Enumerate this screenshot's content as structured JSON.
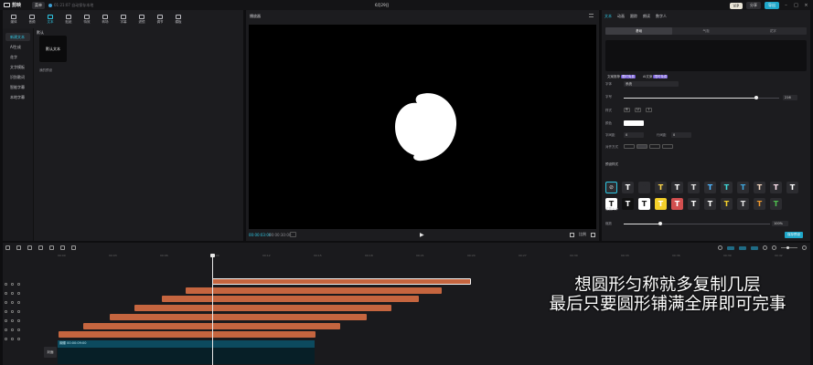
{
  "app": {
    "brand": "剪映",
    "menu_label": "菜单",
    "autosave": "01:21:07 自动保存本地",
    "project_title": "6月29日",
    "vip_label": "VIP",
    "share_label": "分享",
    "export_label": "导出"
  },
  "tools": [
    {
      "label": "媒体",
      "icon": "media-icon"
    },
    {
      "label": "音频",
      "icon": "audio-icon"
    },
    {
      "label": "文本",
      "icon": "text-icon"
    },
    {
      "label": "贴纸",
      "icon": "sticker-icon"
    },
    {
      "label": "特效",
      "icon": "effects-icon"
    },
    {
      "label": "转场",
      "icon": "transition-icon"
    },
    {
      "label": "字幕",
      "icon": "caption-icon"
    },
    {
      "label": "滤镜",
      "icon": "filter-icon"
    },
    {
      "label": "调节",
      "icon": "adjust-icon"
    },
    {
      "label": "模板",
      "icon": "template-icon"
    }
  ],
  "categories": [
    "新建文本",
    "AI生成",
    "花字",
    "文字模板",
    "识别歌词",
    "智能字幕",
    "本地字幕"
  ],
  "library": {
    "heading": "默认",
    "card_text": "默认文本",
    "caption": "我的预设"
  },
  "player": {
    "title": "播放器",
    "time_current": "00:00:03:00",
    "time_total": "00:00:30:00",
    "ratio_label": "比例"
  },
  "inspector": {
    "tabs": [
      "文本",
      "动画",
      "跟踪",
      "朗读",
      "数字人"
    ],
    "subtabs": [
      "基础",
      "气泡",
      "花字"
    ],
    "ai_buttons": [
      {
        "label": "文案推荐",
        "badge": "限时免费"
      },
      {
        "label": "AI文案",
        "badge": "限时免费"
      }
    ],
    "font_label": "字体",
    "font_value": "系统",
    "size_label": "字号",
    "size_value": "216",
    "size_fraction": 0.85,
    "style_label": "样式",
    "style_buttons": [
      "B",
      "U",
      "I"
    ],
    "color_label": "颜色",
    "color_value": "#ffffff",
    "spacing_label": "字间距",
    "spacing_value": "0",
    "line_label": "行间距",
    "line_value": "0",
    "align_label": "对齐方式",
    "preset_label": "预设样式",
    "opacity_section": "位置大小",
    "scale_label": "缩放",
    "scale_value": "100%",
    "scale_fraction": 0.25,
    "save_preset": "保存预设"
  },
  "presets": [
    {
      "bg": "#2c2c30",
      "fg": "#bbbbbb",
      "glyph": "⊘"
    },
    {
      "bg": "#2c2c30",
      "fg": "#ffffff",
      "glyph": "T"
    },
    {
      "bg": "#2c2c30",
      "fg": "#2c2c30",
      "glyph": "T"
    },
    {
      "bg": "#2c2c30",
      "fg": "#ffd84a",
      "glyph": "T"
    },
    {
      "bg": "#2c2c30",
      "fg": "#ffffff",
      "glyph": "T"
    },
    {
      "bg": "#2c2c30",
      "fg": "#e6e6e6",
      "glyph": "T"
    },
    {
      "bg": "#2c2c30",
      "fg": "#4fb6ff",
      "glyph": "T"
    },
    {
      "bg": "#2c2c30",
      "fg": "#3fd8d8",
      "glyph": "T"
    },
    {
      "bg": "#2c2c30",
      "fg": "#3fa8e0",
      "glyph": "T"
    },
    {
      "bg": "#2c2c30",
      "fg": "#f5d7c0",
      "glyph": "T"
    },
    {
      "bg": "#2c2c30",
      "fg": "#ffe3ef",
      "glyph": "T"
    },
    {
      "bg": "#2c2c30",
      "fg": "#ffffff",
      "glyph": "T"
    },
    {
      "bg": "#ffffff",
      "fg": "#111111",
      "glyph": "T"
    },
    {
      "bg": "#111111",
      "fg": "#ffffff",
      "glyph": "T"
    },
    {
      "bg": "#ffffff",
      "fg": "#111111",
      "glyph": "T"
    },
    {
      "bg": "#f4d02a",
      "fg": "#ffffff",
      "glyph": "T"
    },
    {
      "bg": "#d24f4f",
      "fg": "#ffffff",
      "glyph": "T"
    },
    {
      "bg": "#2c2c30",
      "fg": "#ffffff",
      "glyph": "T"
    },
    {
      "bg": "#2c2c30",
      "fg": "#ffffff",
      "glyph": "T"
    },
    {
      "bg": "#2c2c30",
      "fg": "#f4d02a",
      "glyph": "T"
    },
    {
      "bg": "#2c2c30",
      "fg": "#e6e6e6",
      "glyph": "T"
    },
    {
      "bg": "#2c2c30",
      "fg": "#f29a2e",
      "glyph": "T"
    },
    {
      "bg": "#2c2c30",
      "fg": "#4fbf4f",
      "glyph": "T"
    }
  ],
  "timeline": {
    "ruler_ticks": [
      "00:00",
      "00:03",
      "00:06",
      "00:09",
      "00:12",
      "00:15",
      "00:18",
      "00:21",
      "00:24",
      "00:27",
      "00:30",
      "00:33",
      "00:36",
      "00:39",
      "00:42"
    ],
    "main_track_label": "蝴蝶  00:00:09:00",
    "cover_label": "封面"
  },
  "caption_lines": [
    "想圆形匀称就多复制几层",
    "最后只要圆形铺满全屏即可完事"
  ]
}
